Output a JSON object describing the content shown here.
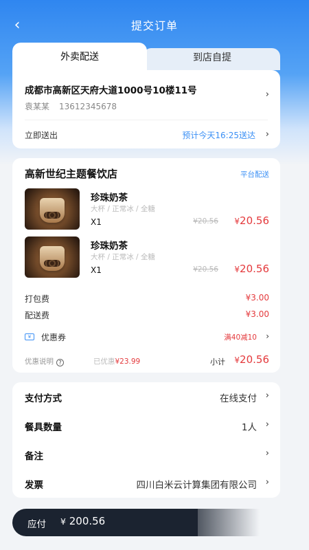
{
  "header": {
    "title": "提交订单",
    "back_icon": "chevron-left-icon"
  },
  "tabs": [
    {
      "label": "外卖配送",
      "active": true
    },
    {
      "label": "到店自提",
      "active": false
    }
  ],
  "address": {
    "line": "成都市高新区天府大道1000号10楼11号",
    "name": "袁某某",
    "phone": "13612345678"
  },
  "delivery": {
    "label": "立即送出",
    "eta": "预计今天16:25送达"
  },
  "shop": {
    "name": "高新世纪主题餐饮店",
    "tag": "平台配送",
    "items": [
      {
        "name": "珍珠奶茶",
        "spec": "大杯 / 正常冰 / 全糖",
        "qty": "X1",
        "original_price": "¥20.56",
        "currency": "¥",
        "price": "20.56"
      },
      {
        "name": "珍珠奶茶",
        "spec": "大杯 / 正常冰 / 全糖",
        "qty": "X1",
        "original_price": "¥20.56",
        "currency": "¥",
        "price": "20.56"
      }
    ],
    "fees": [
      {
        "label": "打包费",
        "value": "¥3.00"
      },
      {
        "label": "配送费",
        "value": "¥3.00"
      }
    ],
    "coupon": {
      "label": "优惠券",
      "value": "满40减10"
    },
    "discount": {
      "label": "优惠说明",
      "prefix": "已优惠",
      "amount": "¥23.99"
    },
    "subtotal": {
      "label": "小计",
      "currency": "¥",
      "value": "20.56"
    }
  },
  "options": [
    {
      "label": "支付方式",
      "value": "在线支付"
    },
    {
      "label": "餐具数量",
      "value": "1人"
    },
    {
      "label": "备注",
      "value": ""
    },
    {
      "label": "发票",
      "value": "四川白米云计算集团有限公司"
    }
  ],
  "paybar": {
    "label": "应付",
    "currency": "¥",
    "amount": "200.56"
  },
  "colors": {
    "accent": "#3a8ff5",
    "price": "#e4393c",
    "paybar": "#1b2330"
  }
}
